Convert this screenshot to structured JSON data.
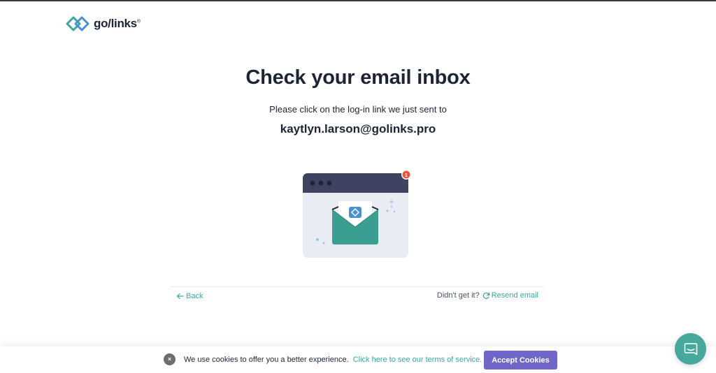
{
  "brand": {
    "logo_text": "go/links",
    "registered": "®"
  },
  "main": {
    "heading": "Check your email inbox",
    "subtext": "Please click on the log-in link we just sent to",
    "email": "kaytlyn.larson@golinks.pro",
    "notification_count": "1"
  },
  "footer_nav": {
    "back_label": "Back",
    "prompt": "Didn't get it?",
    "resend_label": "Resend email"
  },
  "cookie_banner": {
    "close_label": "×",
    "message": "We use cookies to offer you a better experience.",
    "terms_link": "Click here to see our terms of service.",
    "accept_label": "Accept Cookies"
  },
  "colors": {
    "accent": "#3aa89c",
    "button": "#7066c7",
    "chat": "#47a99c",
    "text": "#1d2434"
  },
  "icons": {
    "logo": "golinks-logo-icon",
    "back": "arrow-left-icon",
    "resend": "refresh-icon",
    "chat": "chat-bubble-icon",
    "illustration": "envelope-browser-illustration"
  }
}
